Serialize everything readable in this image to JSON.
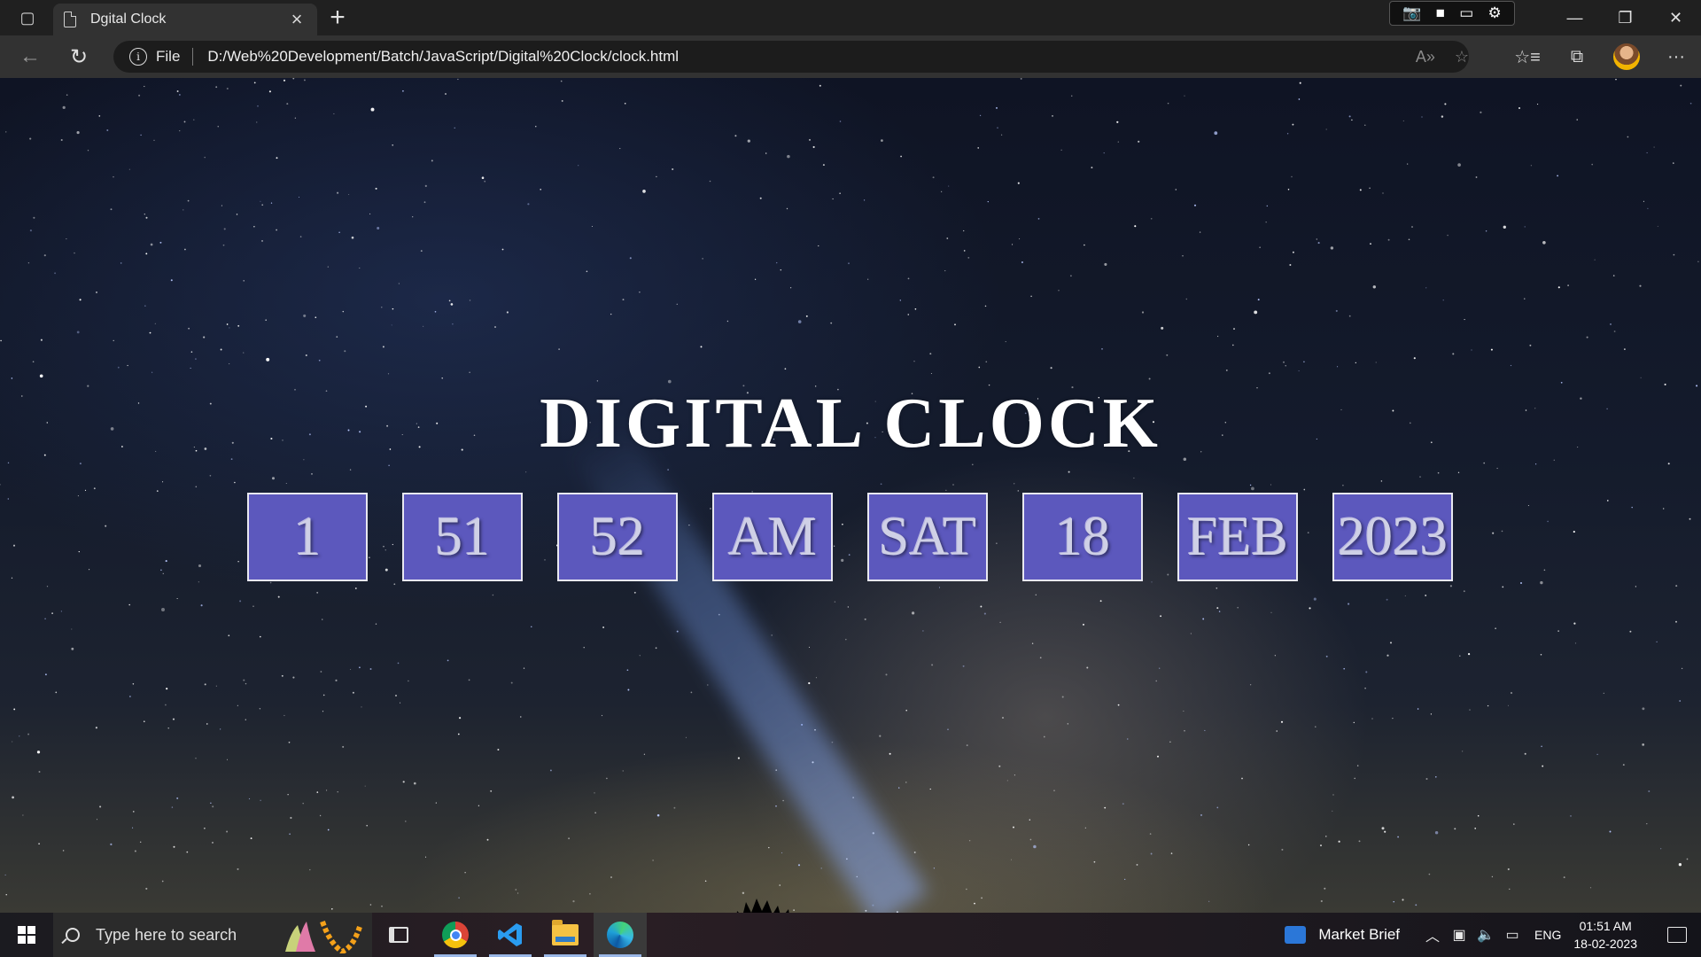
{
  "browser": {
    "tab_title": "Dgital Clock",
    "address": {
      "scheme_label": "File",
      "url": "D:/Web%20Development/Batch/JavaScript/Digital%20Clock/clock.html"
    }
  },
  "page": {
    "heading": "DIGITAL CLOCK",
    "clock": {
      "hours": "1",
      "minutes": "51",
      "seconds": "52",
      "period": "AM",
      "day": "SAT",
      "date": "18",
      "month": "FEB",
      "year": "2023"
    },
    "box_color": "#5c58bd"
  },
  "taskbar": {
    "search_placeholder": "Type here to search",
    "widget_label": "Market Brief",
    "language": "ENG",
    "time": "01:51 AM",
    "date": "18-02-2023",
    "apps": [
      "task-view",
      "chrome",
      "vscode",
      "file-explorer",
      "edge"
    ]
  }
}
